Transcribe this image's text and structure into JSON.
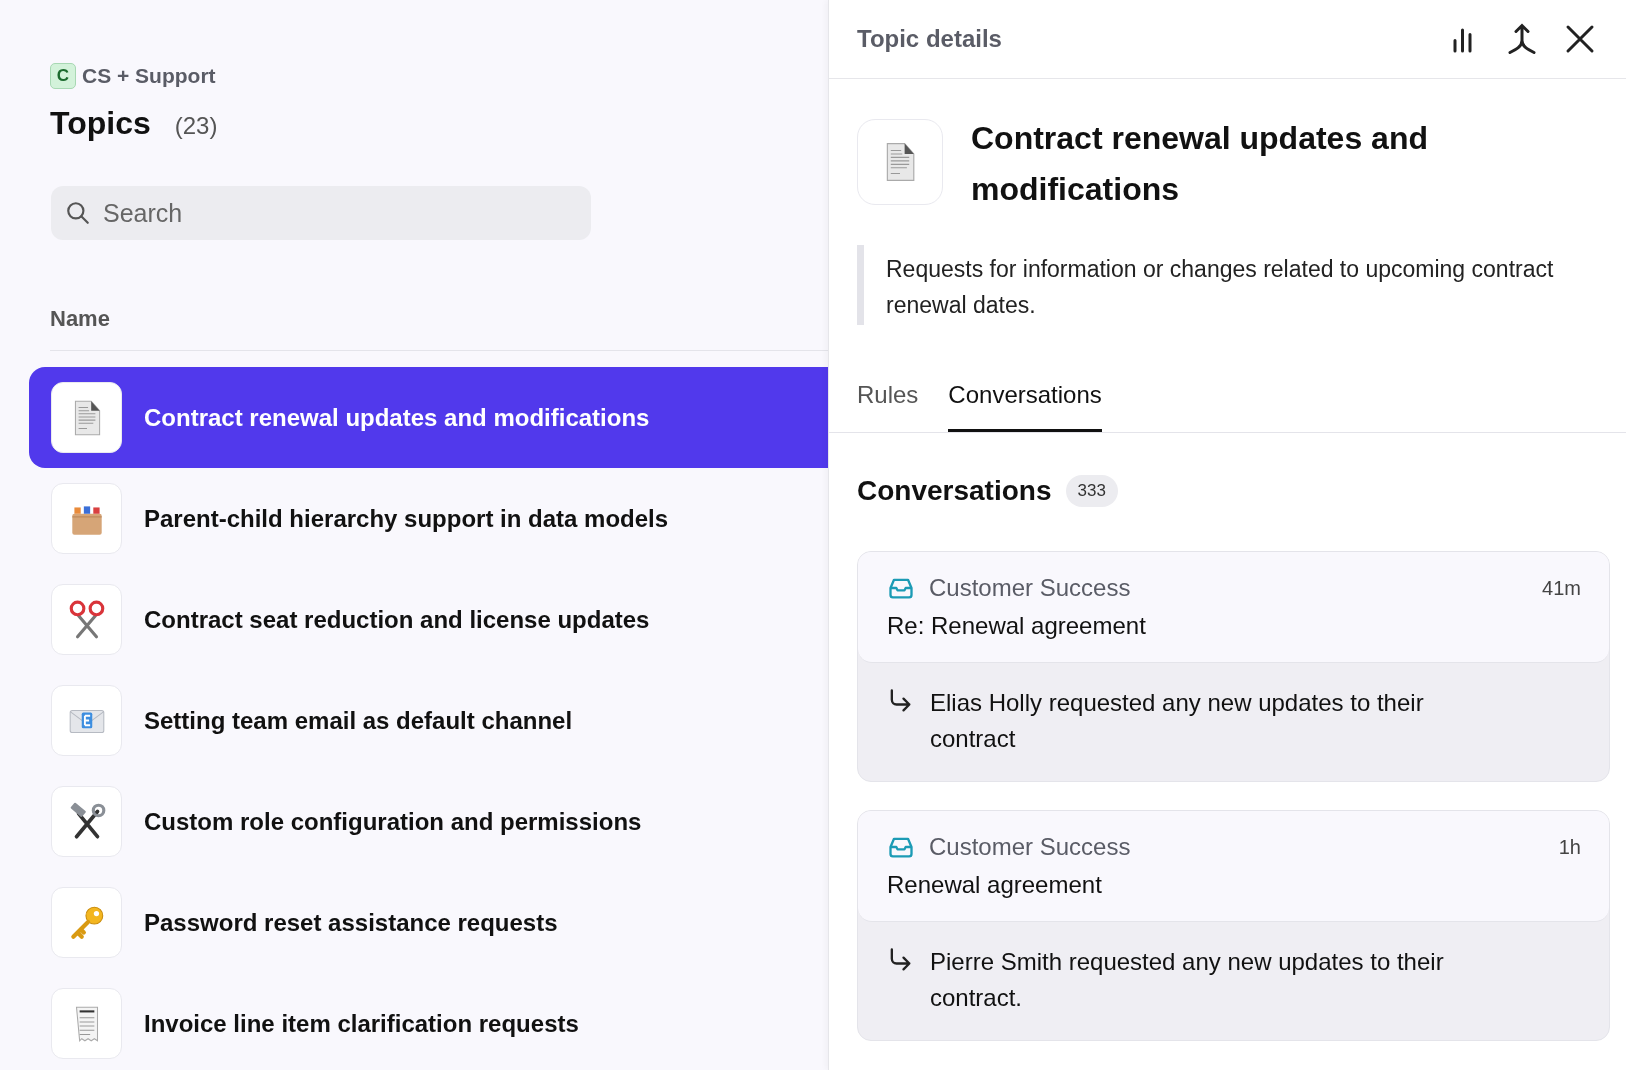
{
  "workspace": {
    "badge": "C",
    "name": "CS + Support"
  },
  "page": {
    "title": "Topics",
    "count": "(23)"
  },
  "search": {
    "placeholder": "Search"
  },
  "table": {
    "columns": [
      "Name"
    ],
    "rows": [
      {
        "kind": "document",
        "name": "Contract renewal updates and modifications",
        "selected": true
      },
      {
        "kind": "cabinet",
        "name": "Parent-child hierarchy support in data models",
        "selected": false
      },
      {
        "kind": "scissors",
        "name": "Contract seat reduction and license updates",
        "selected": false
      },
      {
        "kind": "envelope",
        "name": "Setting team email as default channel",
        "selected": false
      },
      {
        "kind": "tools",
        "name": "Custom role configuration and permissions",
        "selected": false
      },
      {
        "kind": "key",
        "name": "Password reset assistance requests",
        "selected": false
      },
      {
        "kind": "receipt",
        "name": "Invoice line item clarification requests",
        "selected": false
      }
    ]
  },
  "details": {
    "header": "Topic details",
    "kind": "document",
    "title": "Contract renewal updates and modifications",
    "description": "Requests for information or changes related to upcoming contract renewal dates.",
    "tabs": [
      {
        "label": "Rules",
        "selected": false
      },
      {
        "label": "Conversations",
        "selected": true
      }
    ],
    "section": {
      "title": "Conversations",
      "count": "333"
    },
    "conversations": [
      {
        "inbox": "Customer Success",
        "time": "41m",
        "subject": "Re: Renewal agreement",
        "summary": "Elias Holly requested any new updates to their contract"
      },
      {
        "inbox": "Customer Success",
        "time": "1h",
        "subject": "Renewal agreement",
        "summary": "Pierre Smith requested any new updates to their contract."
      }
    ]
  }
}
